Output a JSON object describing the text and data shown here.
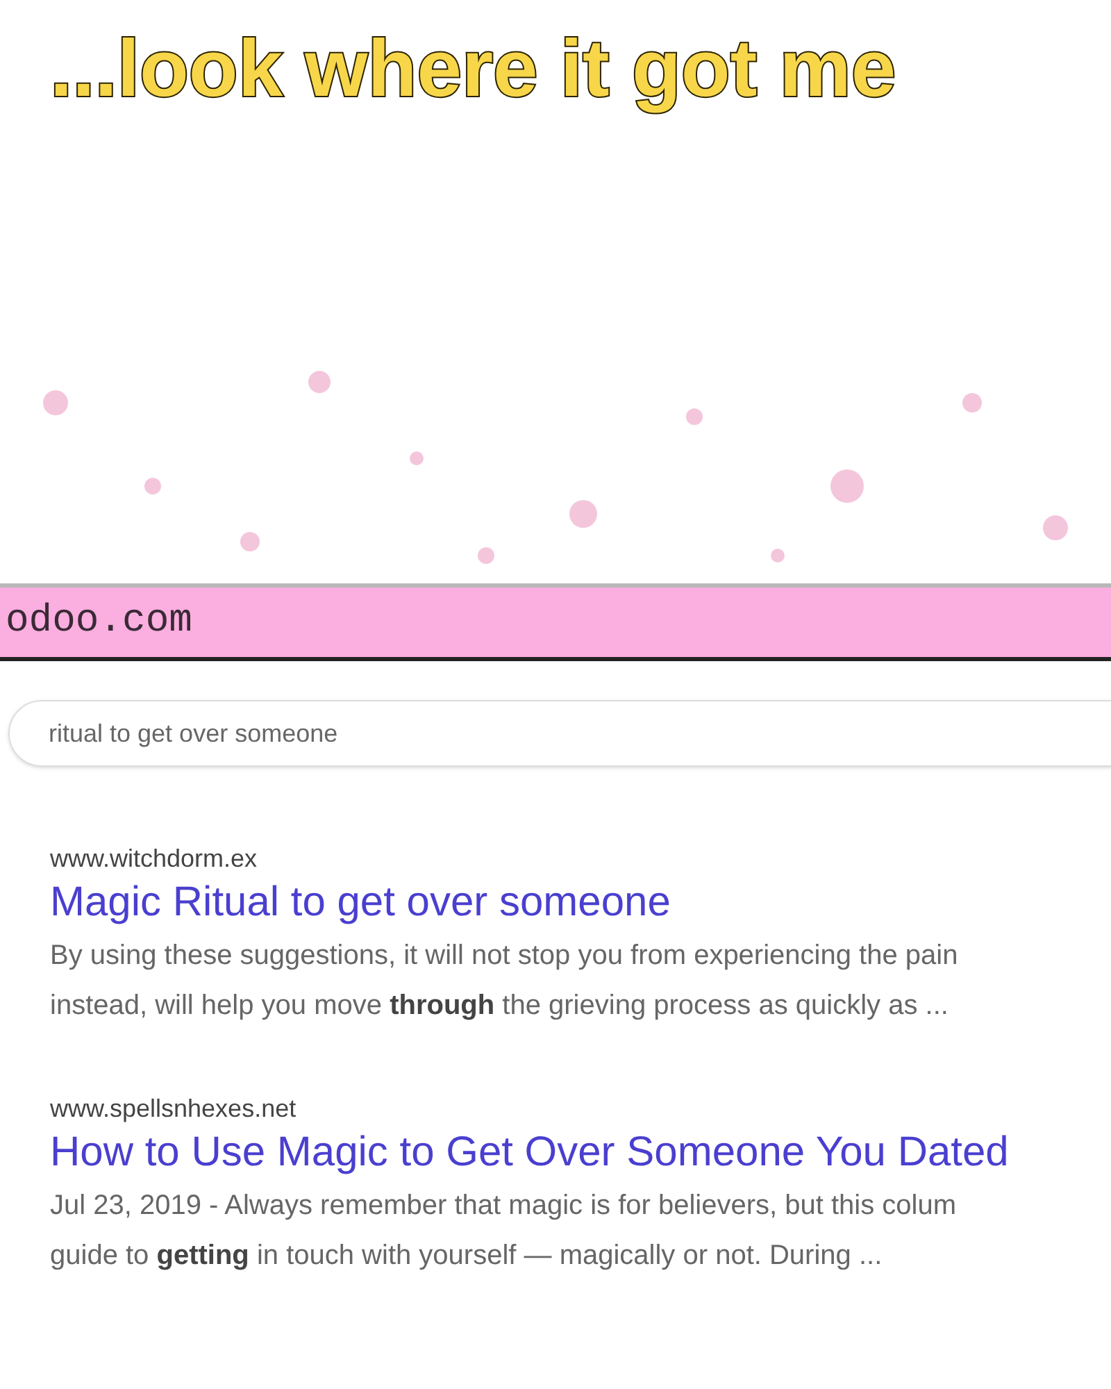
{
  "caption": "...look where it got me",
  "address_bar": {
    "url": "odoo.com"
  },
  "search": {
    "value": "ritual to get over someone"
  },
  "results": [
    {
      "site": "www.witchdorm.ex",
      "title": "Magic Ritual to get over someone",
      "snippet_lines": [
        "By using these suggestions, it will not stop you from experiencing the pain",
        "instead, will help you move **through** the grieving process as quickly as ..."
      ]
    },
    {
      "site": "www.spellsnhexes.net",
      "title": "How to Use Magic to Get Over Someone You Dated",
      "snippet_lines": [
        "Jul 23, 2019 - Always remember that magic is for believers, but this colum",
        "guide to **getting** in touch with yourself — magically or not. During ..."
      ]
    }
  ]
}
